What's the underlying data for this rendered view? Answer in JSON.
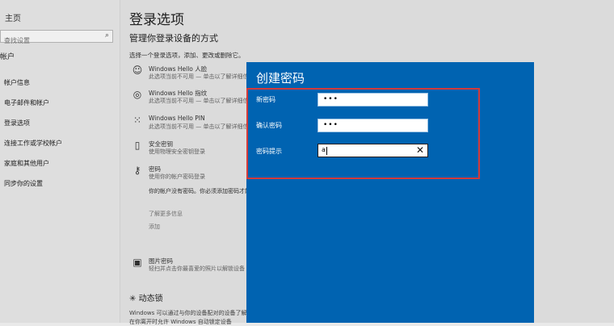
{
  "sidebar": {
    "home": "主页",
    "search_placeholder": "查找设置",
    "section": "帐户",
    "items": [
      "帐户信息",
      "电子邮件和帐户",
      "登录选项",
      "连接工作或学校帐户",
      "家庭和其他用户",
      "同步你的设置"
    ]
  },
  "main": {
    "title": "登录选项",
    "subtitle": "管理你登录设备的方式",
    "choose": "选择一个登录选项，添加、更改或删除它。",
    "options": [
      {
        "icon": "smile-icon",
        "title": "Windows Hello 人脸",
        "desc": "此选项当前不可用 — 单击以了解详细信息"
      },
      {
        "icon": "fingerprint-icon",
        "title": "Windows Hello 指纹",
        "desc": "此选项当前不可用 — 单击以了解详细信息"
      },
      {
        "icon": "keypad-icon",
        "title": "Windows Hello PIN",
        "desc": "此选项当前不可用 — 单击以了解详细信息"
      },
      {
        "icon": "usb-key-icon",
        "title": "安全密钥",
        "desc": "使用物理安全密钥登录"
      },
      {
        "icon": "key-icon",
        "title": "密码",
        "desc": "使用你的帐户密码登录"
      }
    ],
    "password_detail": {
      "text": "你的帐户没有密码。你必须添加密码才能使用其他登录选项。",
      "link1": "了解更多信息",
      "add_button": "添加"
    },
    "picture_password": {
      "title": "图片密码",
      "desc": "轻扫并点击你最喜爱的照片以解锁设备"
    },
    "dynamic_lock": {
      "title": "动态锁",
      "text": "Windows 可以通过与你的设备配对的设备了解你何时离开。",
      "text2": "在你离开时允许 Windows 自动锁定设备"
    }
  },
  "dialog": {
    "title": "创建密码",
    "new_password_label": "新密码",
    "new_password_value": "•••",
    "confirm_label": "确认密码",
    "confirm_value": "•••",
    "hint_label": "密码提示",
    "hint_value": "a",
    "clear_glyph": "✕"
  },
  "colors": {
    "dialog_bg": "#0063b1",
    "highlight": "#d43a3a"
  }
}
